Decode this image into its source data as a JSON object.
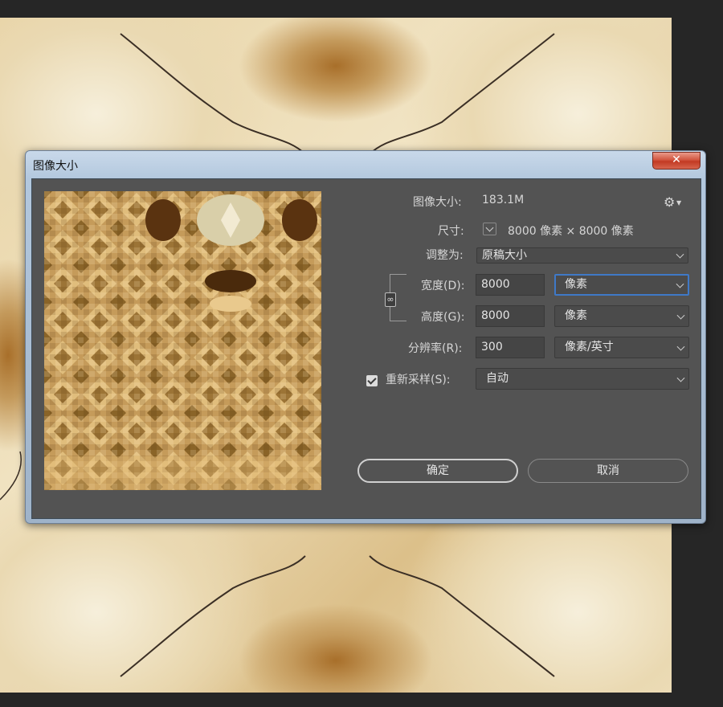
{
  "dialog": {
    "title": "图像大小",
    "close_label": "✕"
  },
  "info": {
    "image_size_label": "图像大小:",
    "image_size_value": "183.1M",
    "dimensions_label": "尺寸:",
    "dimensions_value": "8000 像素  ×  8000 像素",
    "fit_to_label": "调整为:",
    "fit_to_value": "原稿大小"
  },
  "fields": {
    "width_label": "宽度(D):",
    "width_value": "8000",
    "width_unit": "像素",
    "height_label": "高度(G):",
    "height_value": "8000",
    "height_unit": "像素",
    "resolution_label": "分辨率(R):",
    "resolution_value": "300",
    "resolution_unit": "像素/英寸",
    "resample_label": "重新采样(S):",
    "resample_checked": true,
    "resample_value": "自动"
  },
  "buttons": {
    "ok": "确定",
    "cancel": "取消"
  },
  "icons": {
    "gear": "gear-icon",
    "link": "link-icon",
    "close": "close-icon",
    "chevron": "chevron-down-icon"
  },
  "colors": {
    "dialog_bg": "#535353",
    "focus_border": "#3f79c7",
    "close_red": "#c23a23"
  }
}
